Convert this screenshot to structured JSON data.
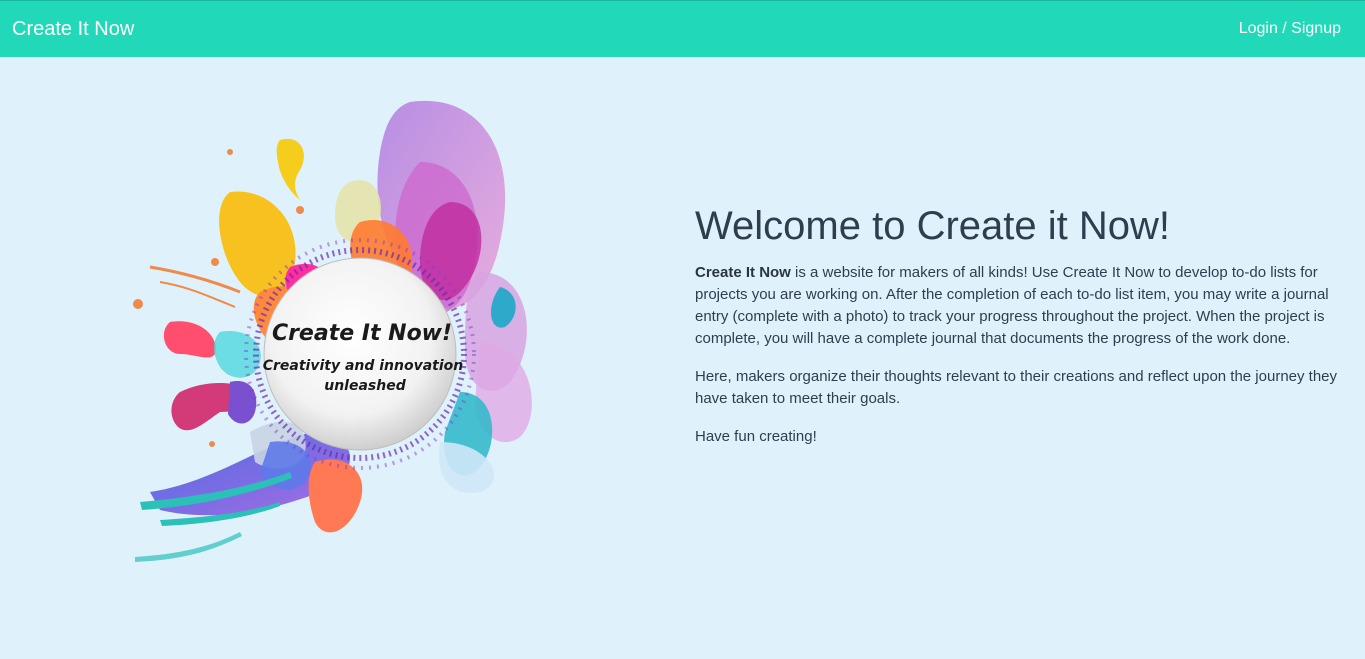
{
  "navbar": {
    "brand": "Create It Now",
    "login_label": "Login / Signup",
    "bg_color": "#21d8b8"
  },
  "hero_image": {
    "badge_title": "Create It Now!",
    "badge_line1": "Creativity and innovation",
    "badge_line2": "unleashed"
  },
  "main": {
    "heading": "Welcome to Create it Now!",
    "intro_bold": "Create It Now",
    "intro_rest": " is a website for makers of all kinds! Use Create It Now to develop to-do lists for projects you are working on. After the completion of each to-do list item, you may write a journal entry (complete with a photo) to track your progress throughout the project. When the project is complete, you will have a complete journal that documents the progress of the work done.",
    "paragraph2": "Here, makers organize their thoughts relevant to their creations and reflect upon the journey they have taken to meet their goals.",
    "paragraph3": "Have fun creating!"
  },
  "page_bg_color": "#dff2fb"
}
